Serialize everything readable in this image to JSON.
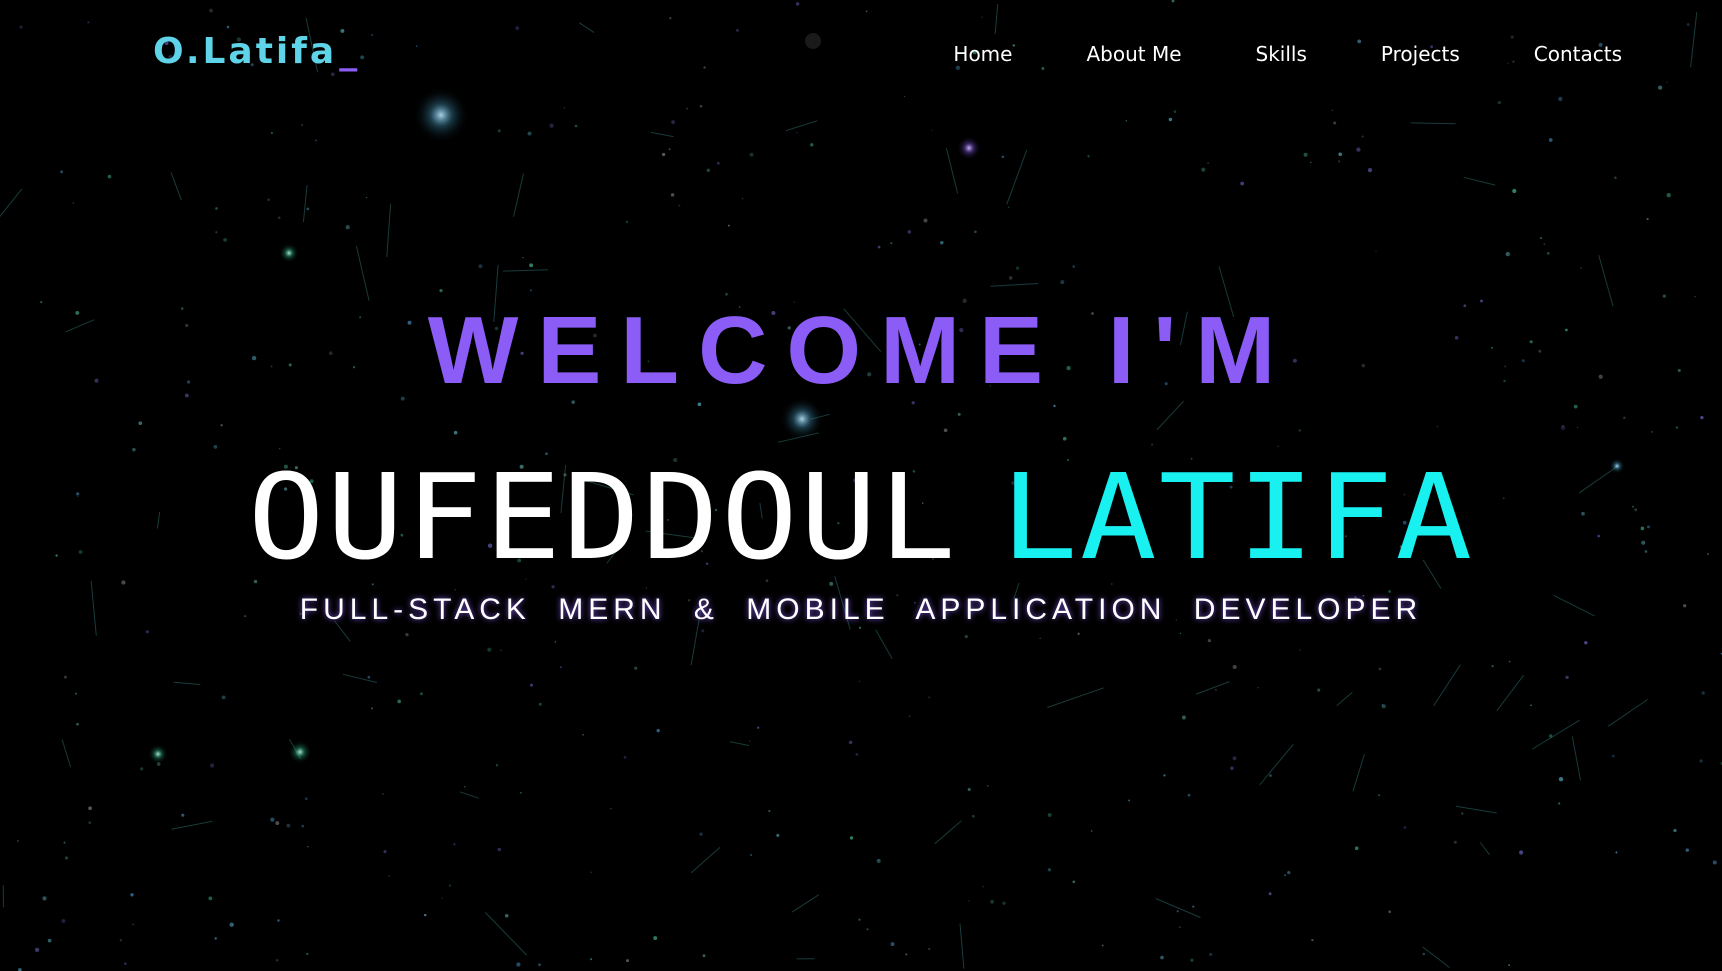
{
  "logo": {
    "text": "O.Latifa",
    "cursor": "_"
  },
  "nav": {
    "items": [
      {
        "label": "Home"
      },
      {
        "label": "About Me"
      },
      {
        "label": "Skills"
      },
      {
        "label": "Projects"
      },
      {
        "label": "Contacts"
      }
    ]
  },
  "hero": {
    "welcome": "WELCOME I'M",
    "first_name": "OUFEDDOUL",
    "last_name": "LATIFA",
    "tagline": "FULL-STACK MERN & MOBILE APPLICATION DEVELOPER"
  },
  "colors": {
    "background": "#000000",
    "logo": "#5fd4e8",
    "accent_purple": "#8b5cf6",
    "accent_cyan": "#19f0f0",
    "text": "#ffffff"
  }
}
